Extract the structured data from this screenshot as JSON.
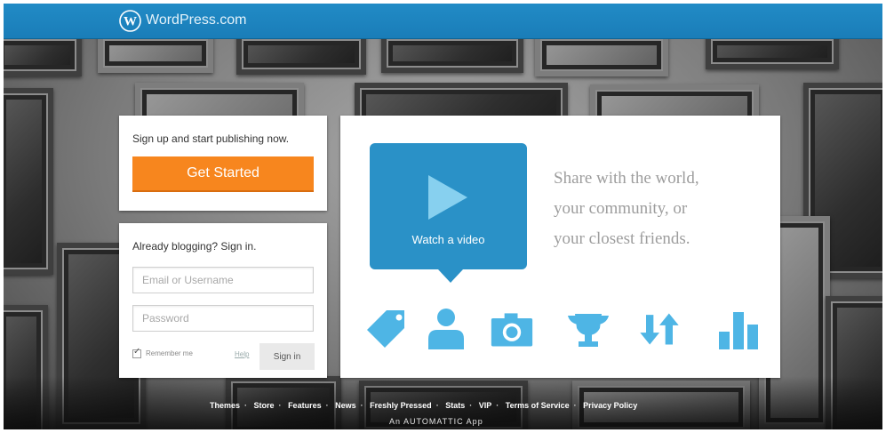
{
  "header": {
    "brand": "WordPress.com"
  },
  "signup": {
    "text": "Sign up and start publishing now.",
    "button_label": "Get Started"
  },
  "signin": {
    "title": "Already blogging? Sign in.",
    "username_placeholder": "Email or Username",
    "password_placeholder": "Password",
    "remember_label": "Remember me",
    "help_label": "Help",
    "button_label": "Sign in"
  },
  "main": {
    "video_label": "Watch a video",
    "tagline_lines": [
      "Share with the world,",
      "your community, or",
      "your closest friends."
    ],
    "icons": [
      "tag-icon",
      "person-icon",
      "camera-icon",
      "trophy-icon",
      "sync-arrows-icon",
      "bar-chart-icon"
    ]
  },
  "footer": {
    "links": [
      "Themes",
      "Store",
      "Features",
      "News",
      "Freshly Pressed",
      "Stats",
      "VIP",
      "Terms of Service",
      "Privacy Policy"
    ],
    "byline": "An AUTOMATTIC App"
  },
  "colors": {
    "brand_blue": "#218bc6",
    "accent_orange": "#f7861e",
    "icon_blue": "#2a91c7"
  }
}
